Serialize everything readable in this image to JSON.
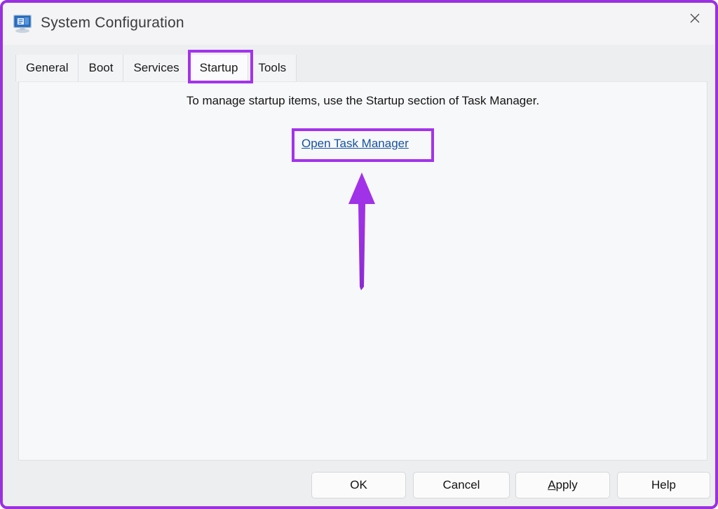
{
  "window": {
    "title": "System Configuration",
    "icon": "system-configuration-monitor-icon",
    "close_label": "✕",
    "border_color": "#9b30e0"
  },
  "tabs": [
    {
      "label": "General",
      "active": false
    },
    {
      "label": "Boot",
      "active": false
    },
    {
      "label": "Services",
      "active": false
    },
    {
      "label": "Startup",
      "active": true
    },
    {
      "label": "Tools",
      "active": false
    }
  ],
  "content": {
    "instruction": "To manage startup items, use the Startup section of Task Manager.",
    "link_label": "Open Task Manager"
  },
  "footer": {
    "buttons": [
      {
        "label": "OK",
        "accel": ""
      },
      {
        "label": "Cancel",
        "accel": ""
      },
      {
        "label": "Apply",
        "accel": "A"
      },
      {
        "label": "Help",
        "accel": ""
      }
    ],
    "ok_label": "OK",
    "cancel_label": "Cancel",
    "apply_accel": "A",
    "apply_rest": "pply",
    "help_label": "Help"
  },
  "annotations": {
    "highlight_color": "#a333ec",
    "boxes": [
      {
        "target": "Startup",
        "type": "tab-highlight"
      },
      {
        "target": "Open Task Manager",
        "type": "link-highlight"
      }
    ],
    "arrow": {
      "direction": "up",
      "points_to": "Open Task Manager",
      "color": "#a333ec"
    }
  }
}
